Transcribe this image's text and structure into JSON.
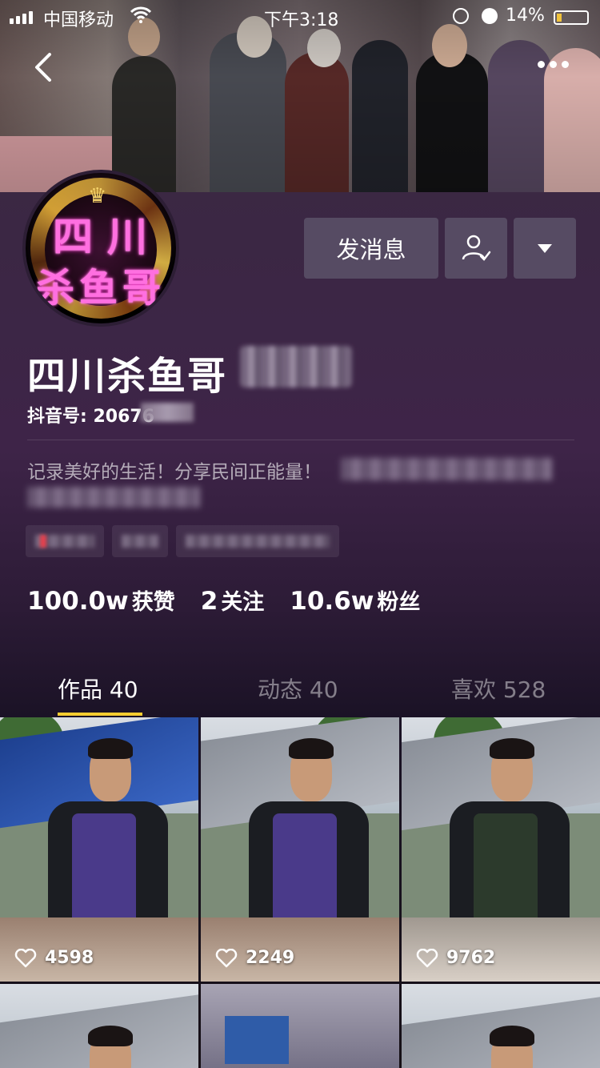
{
  "status_bar": {
    "carrier": "中国移动",
    "time": "下午3:18",
    "battery": "14%"
  },
  "profile": {
    "avatar_line1": "四川",
    "avatar_line2": "杀鱼哥",
    "name": "四川杀鱼哥",
    "uid_label": "抖音号: 20676",
    "bio": "记录美好的生活！分享民间正能量！"
  },
  "actions": {
    "message_label": "发消息"
  },
  "stats": {
    "likes_value": "100.0w",
    "likes_label": "获赞",
    "following_value": "2",
    "following_label": "关注",
    "followers_value": "10.6w",
    "followers_label": "粉丝"
  },
  "tabs": [
    {
      "label": "作品 40",
      "active": true
    },
    {
      "label": "动态 40",
      "active": false
    },
    {
      "label": "喜欢 528",
      "active": false
    }
  ],
  "videos": [
    {
      "likes": "4598"
    },
    {
      "likes": "2249"
    },
    {
      "likes": "9762"
    }
  ],
  "colors": {
    "accent": "#f7cd30",
    "background": "#3e2448"
  }
}
